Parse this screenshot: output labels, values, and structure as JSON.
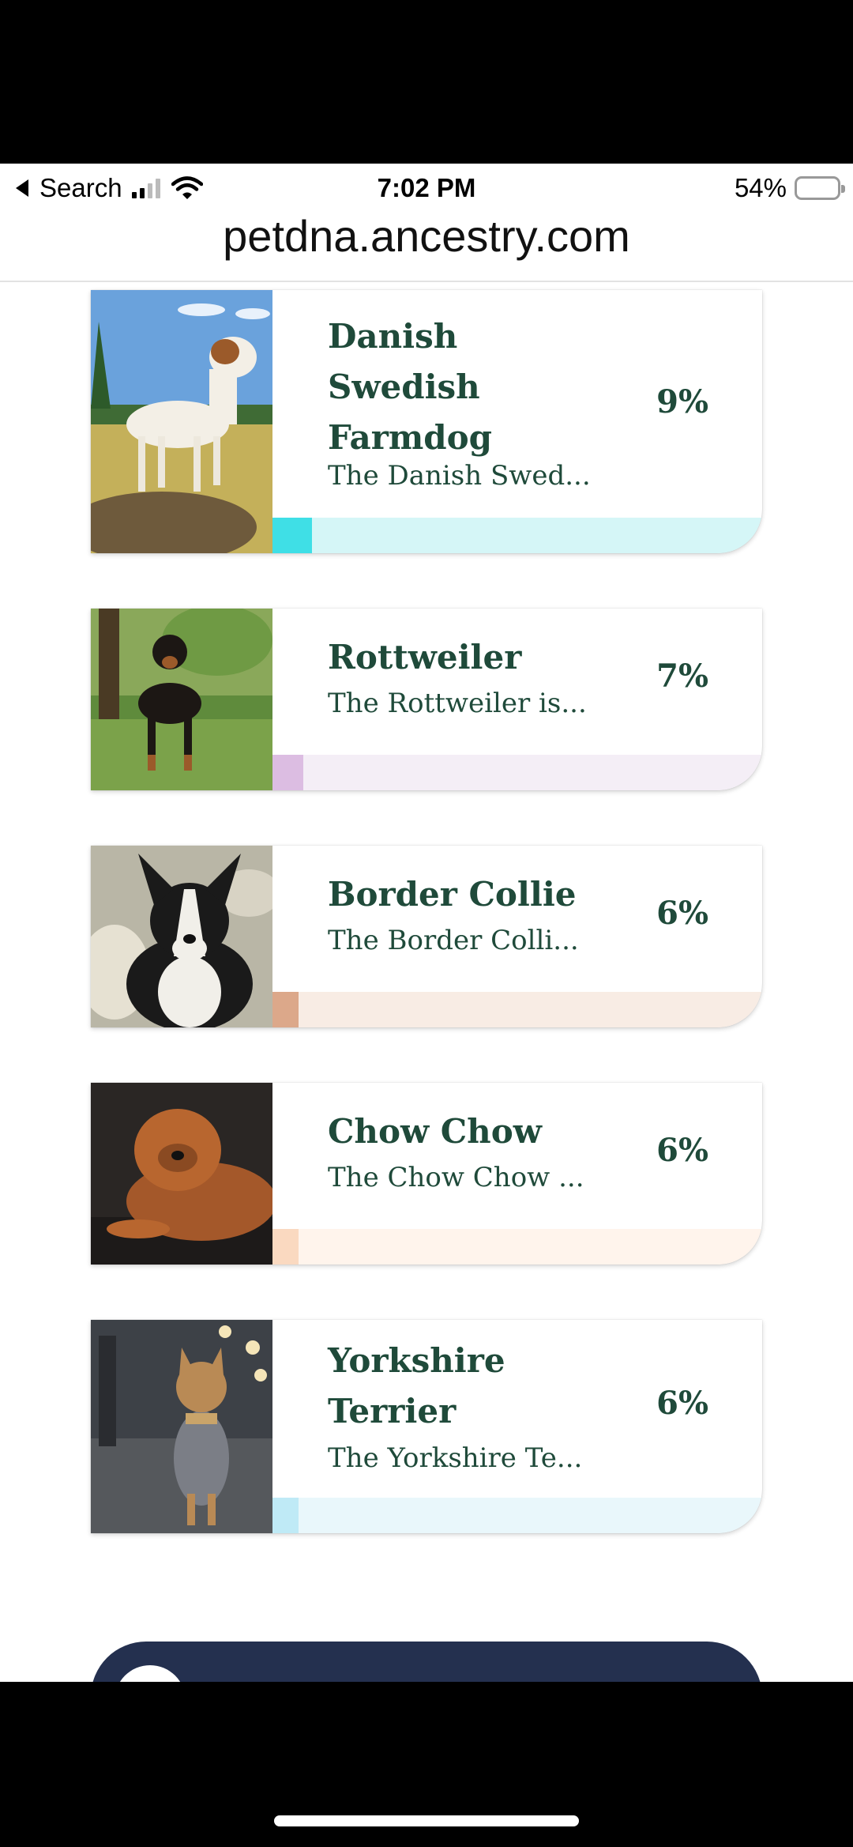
{
  "status_bar": {
    "back_label": "Search",
    "time": "7:02 PM",
    "battery_percent": "54%",
    "battery_level": 0.54,
    "icons": [
      "back-arrow-icon",
      "cellular-signal-icon",
      "wifi-icon",
      "battery-icon"
    ]
  },
  "browser": {
    "url": "petdna.ancestry.com"
  },
  "breeds": [
    {
      "name_lines": [
        "Danish",
        "Swedish",
        "Farmdog"
      ],
      "description": "The Danish Swed...",
      "percent": "9%",
      "share": 0.09,
      "accent": "#3fdfe6",
      "track": "#d5f6f7"
    },
    {
      "name_lines": [
        "Rottweiler"
      ],
      "description": "The Rottweiler is...",
      "percent": "7%",
      "share": 0.07,
      "accent": "#dcbde2",
      "track": "#f4eef6"
    },
    {
      "name_lines": [
        "Border Collie"
      ],
      "description": "The Border Colli...",
      "percent": "6%",
      "share": 0.06,
      "accent": "#dca88a",
      "track": "#f8ece4"
    },
    {
      "name_lines": [
        "Chow Chow"
      ],
      "description": "The Chow Chow ...",
      "percent": "6%",
      "share": 0.06,
      "accent": "#fad9c0",
      "track": "#fff4ec"
    },
    {
      "name_lines": [
        "Yorkshire",
        "Terrier"
      ],
      "description": "The Yorkshire Te...",
      "percent": "6%",
      "share": 0.06,
      "accent": "#bfeaf6",
      "track": "#e9f7fb"
    }
  ]
}
